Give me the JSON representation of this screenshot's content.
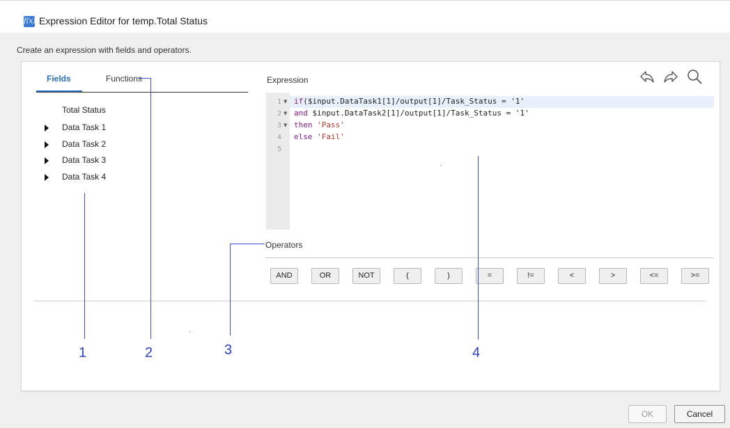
{
  "window": {
    "title": "Expression Editor for temp.Total Status",
    "icon": "fx-icon",
    "icon_text": "f(x)"
  },
  "subtitle": "Create an expression with fields and operators.",
  "tabs": [
    {
      "label": "Fields",
      "active": true
    },
    {
      "label": "Functions",
      "active": false
    }
  ],
  "fields": {
    "root": "Total Status",
    "items": [
      {
        "label": "Data Task 1",
        "expandable": true
      },
      {
        "label": "Data Task 2",
        "expandable": true
      },
      {
        "label": "Data Task 3",
        "expandable": true
      },
      {
        "label": "Data Task 4",
        "expandable": true
      }
    ]
  },
  "expression": {
    "label": "Expression",
    "toolbar": [
      "undo-icon",
      "redo-icon",
      "search-icon"
    ],
    "line_numbers": [
      "1",
      "2",
      "3",
      "4",
      "5"
    ],
    "lines": [
      {
        "kw": "if",
        "rest": "($input.DataTask1[1]/output[1]/Task_Status = '1'"
      },
      {
        "kw": "and",
        "rest": " $input.DataTask2[1]/output[1]/Task_Status = '1'"
      },
      {
        "kw": "then",
        "rest": " 'Pass'"
      },
      {
        "kw": "else",
        "rest": " 'Fail'"
      },
      {
        "kw": "",
        "rest": ""
      }
    ]
  },
  "operators": {
    "label": "Operators",
    "buttons": [
      "AND",
      "OR",
      "NOT",
      "(",
      ")",
      "=",
      "!=",
      "<",
      ">",
      "<=",
      ">="
    ]
  },
  "callouts": [
    "1",
    "2",
    "3",
    "4"
  ],
  "footer": {
    "ok": "OK",
    "cancel": "Cancel"
  },
  "colors": {
    "accent": "#2a6ebd",
    "callout": "#3b50d8",
    "keyword": "#8b1a8b",
    "string": "#c0392b"
  }
}
